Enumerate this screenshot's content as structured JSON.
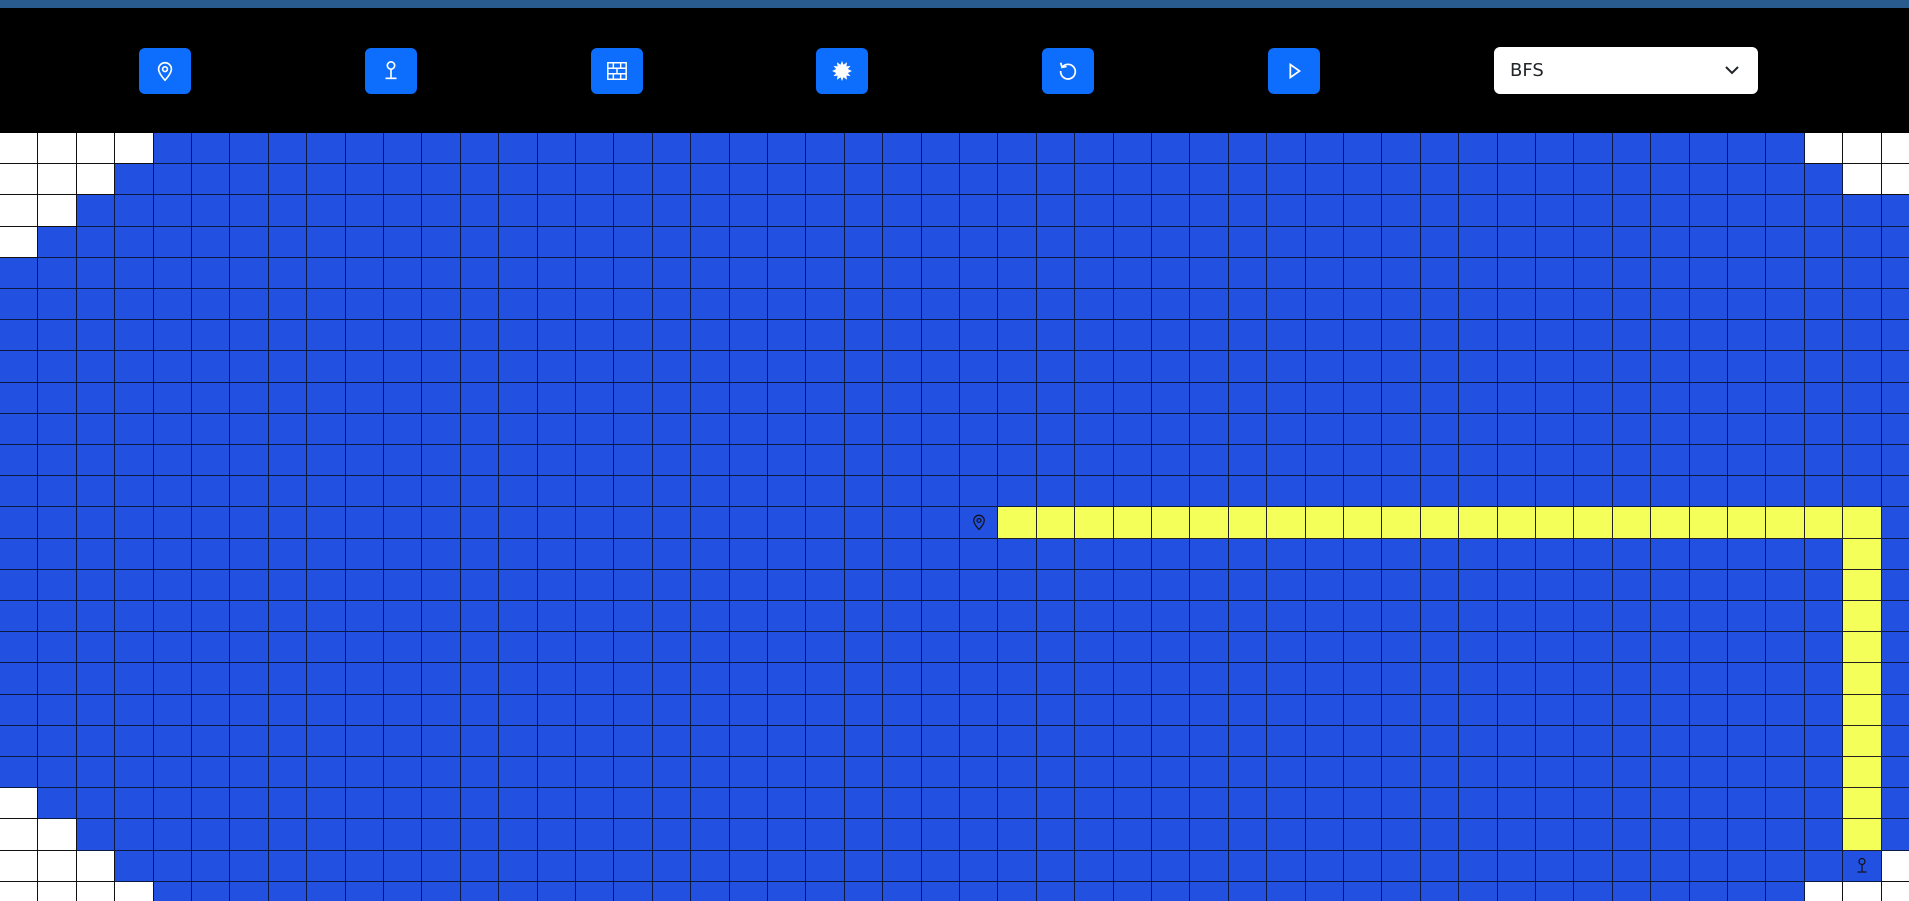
{
  "toolbar": {
    "buttons": [
      {
        "name": "set-start-button",
        "icon": "map-pin-icon"
      },
      {
        "name": "set-end-button",
        "icon": "push-pin-icon"
      },
      {
        "name": "add-walls-button",
        "icon": "brick-wall-icon"
      },
      {
        "name": "clear-board-button",
        "icon": "burst-icon"
      },
      {
        "name": "reset-button",
        "icon": "reset-icon"
      },
      {
        "name": "run-button",
        "icon": "play-icon"
      }
    ],
    "algorithm": {
      "selected": "BFS"
    },
    "accent_color": "#0d6efd"
  },
  "grid": {
    "columns": 50,
    "rows": 25,
    "colors": {
      "visited": "#2250e0",
      "unvisited": "#ffffff",
      "path": "#f4ff5a",
      "grid_lines": "#0b1a40"
    },
    "start": {
      "row": 12,
      "col": 25,
      "icon": "map-pin-icon"
    },
    "end": {
      "row": 23,
      "col": 48,
      "icon": "push-pin-icon"
    },
    "path": [
      [
        12,
        26
      ],
      [
        12,
        27
      ],
      [
        12,
        28
      ],
      [
        12,
        29
      ],
      [
        12,
        30
      ],
      [
        12,
        31
      ],
      [
        12,
        32
      ],
      [
        12,
        33
      ],
      [
        12,
        34
      ],
      [
        12,
        35
      ],
      [
        12,
        36
      ],
      [
        12,
        37
      ],
      [
        12,
        38
      ],
      [
        12,
        39
      ],
      [
        12,
        40
      ],
      [
        12,
        41
      ],
      [
        12,
        42
      ],
      [
        12,
        43
      ],
      [
        12,
        44
      ],
      [
        12,
        45
      ],
      [
        12,
        46
      ],
      [
        12,
        47
      ],
      [
        12,
        48
      ],
      [
        13,
        48
      ],
      [
        14,
        48
      ],
      [
        15,
        48
      ],
      [
        16,
        48
      ],
      [
        17,
        48
      ],
      [
        18,
        48
      ],
      [
        19,
        48
      ],
      [
        20,
        48
      ],
      [
        21,
        48
      ],
      [
        22,
        48
      ]
    ],
    "unvisited": [
      [
        0,
        0
      ],
      [
        0,
        1
      ],
      [
        0,
        2
      ],
      [
        0,
        3
      ],
      [
        1,
        0
      ],
      [
        1,
        1
      ],
      [
        1,
        2
      ],
      [
        2,
        0
      ],
      [
        2,
        1
      ],
      [
        3,
        0
      ],
      [
        0,
        47
      ],
      [
        0,
        48
      ],
      [
        0,
        49
      ],
      [
        1,
        48
      ],
      [
        1,
        49
      ],
      [
        21,
        0
      ],
      [
        22,
        0
      ],
      [
        22,
        1
      ],
      [
        23,
        0
      ],
      [
        23,
        1
      ],
      [
        23,
        2
      ],
      [
        24,
        0
      ],
      [
        24,
        1
      ],
      [
        24,
        2
      ],
      [
        24,
        3
      ],
      [
        23,
        49
      ],
      [
        24,
        47
      ],
      [
        24,
        48
      ],
      [
        24,
        49
      ]
    ]
  }
}
